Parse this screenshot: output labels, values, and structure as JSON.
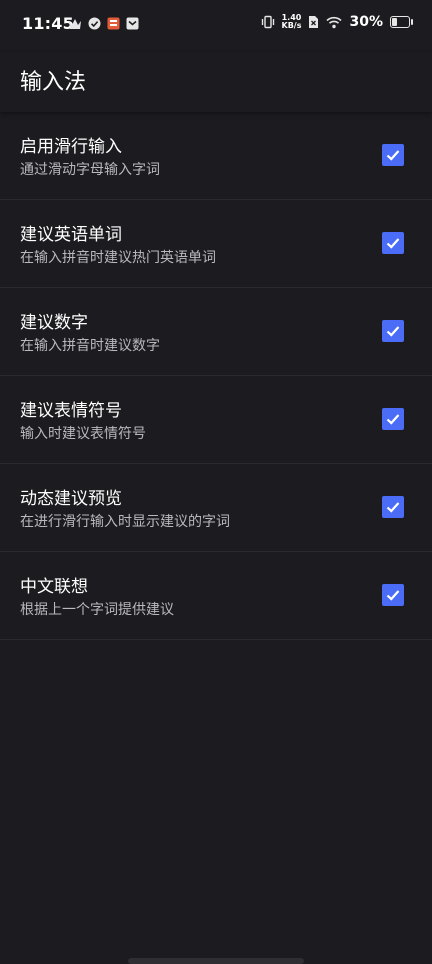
{
  "status_bar": {
    "time": "11:45",
    "net_speed_value": "1.40",
    "net_speed_unit": "KB/s",
    "battery_text": "30%",
    "battery_level": 0.3
  },
  "header": {
    "title": "输入法"
  },
  "settings": [
    {
      "title": "启用滑行输入",
      "subtitle": "通过滑动字母输入字词",
      "checked": true
    },
    {
      "title": "建议英语单词",
      "subtitle": "在输入拼音时建议热门英语单词",
      "checked": true
    },
    {
      "title": "建议数字",
      "subtitle": "在输入拼音时建议数字",
      "checked": true
    },
    {
      "title": "建议表情符号",
      "subtitle": "输入时建议表情符号",
      "checked": true
    },
    {
      "title": "动态建议预览",
      "subtitle": "在进行滑行输入时显示建议的字词",
      "checked": true
    },
    {
      "title": "中文联想",
      "subtitle": "根据上一个字词提供建议",
      "checked": true
    }
  ],
  "colors": {
    "background": "#1c1c20",
    "accent": "#4a6cf7",
    "divider": "#2a2a2f"
  }
}
